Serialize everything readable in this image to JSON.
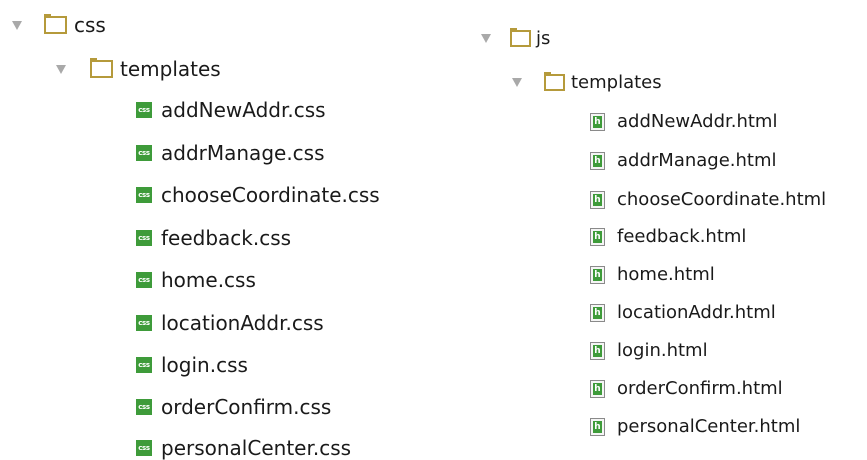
{
  "left_tree": {
    "root": {
      "label": "css",
      "expanded": true
    },
    "subfolder": {
      "label": "templates",
      "expanded": true
    },
    "files": [
      {
        "name": "addNewAddr.css",
        "icon": "css"
      },
      {
        "name": "addrManage.css",
        "icon": "css"
      },
      {
        "name": "chooseCoordinate.css",
        "icon": "css"
      },
      {
        "name": "feedback.css",
        "icon": "css"
      },
      {
        "name": "home.css",
        "icon": "css"
      },
      {
        "name": "locationAddr.css",
        "icon": "css"
      },
      {
        "name": "login.css",
        "icon": "css"
      },
      {
        "name": "orderConfirm.css",
        "icon": "css"
      },
      {
        "name": "personalCenter.css",
        "icon": "css"
      }
    ]
  },
  "right_tree": {
    "root": {
      "label": "js",
      "expanded": true
    },
    "subfolder": {
      "label": "templates",
      "expanded": true
    },
    "files": [
      {
        "name": "addNewAddr.html",
        "icon": "h"
      },
      {
        "name": "addrManage.html",
        "icon": "h"
      },
      {
        "name": "chooseCoordinate.html",
        "icon": "h"
      },
      {
        "name": "feedback.html",
        "icon": "h"
      },
      {
        "name": "home.html",
        "icon": "h"
      },
      {
        "name": "locationAddr.html",
        "icon": "h"
      },
      {
        "name": "login.html",
        "icon": "h"
      },
      {
        "name": "orderConfirm.html",
        "icon": "h"
      },
      {
        "name": "personalCenter.html",
        "icon": "h"
      }
    ]
  },
  "colors": {
    "folder": "#b59a3b",
    "file_icon_green": "#3e9b3a",
    "arrow": "#a9a9a9",
    "text": "#1a1a1a"
  }
}
